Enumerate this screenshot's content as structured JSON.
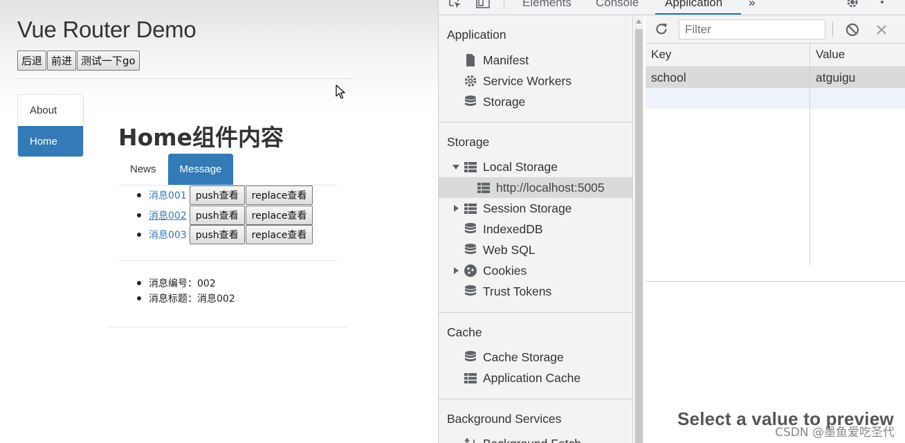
{
  "page": {
    "title": "Vue Router Demo",
    "nav_buttons": [
      "后退",
      "前进",
      "测试一下go"
    ],
    "side_nav": [
      {
        "label": "About",
        "active": false
      },
      {
        "label": "Home",
        "active": true
      }
    ],
    "home_title": "Home组件内容",
    "tabs": [
      {
        "label": "News",
        "active": false
      },
      {
        "label": "Message",
        "active": true
      }
    ],
    "messages": [
      {
        "title": "消息001",
        "push": "push查看",
        "replace": "replace查看"
      },
      {
        "title": "消息002",
        "push": "push查看",
        "replace": "replace查看"
      },
      {
        "title": "消息003",
        "push": "push查看",
        "replace": "replace查看"
      }
    ],
    "detail": [
      "消息编号：002",
      "消息标题：消息002"
    ]
  },
  "devtools": {
    "tabs": [
      "Elements",
      "Console",
      "Application",
      "»"
    ],
    "active_tab": "Application",
    "sidebar": {
      "application_title": "Application",
      "application_items": [
        "Manifest",
        "Service Workers",
        "Storage"
      ],
      "storage_title": "Storage",
      "storage_items": {
        "local_storage": "Local Storage",
        "local_storage_origin": "http://localhost:5005",
        "session_storage": "Session Storage",
        "indexeddb": "IndexedDB",
        "websql": "Web SQL",
        "cookies": "Cookies",
        "trust_tokens": "Trust Tokens"
      },
      "cache_title": "Cache",
      "cache_items": [
        "Cache Storage",
        "Application Cache"
      ],
      "background_title": "Background Services",
      "background_items": [
        "Background Fetch"
      ]
    },
    "filter_placeholder": "Filter",
    "table": {
      "headers": [
        "Key",
        "Value"
      ],
      "rows": [
        {
          "key": "school",
          "value": "atguigu"
        }
      ]
    },
    "preview_text": "Select a value to preview",
    "colors": {
      "accent": "#1a73e8",
      "bootstrap_primary": "#337ab7"
    }
  },
  "watermark": "CSDN @墨鱼爱吃圣代"
}
